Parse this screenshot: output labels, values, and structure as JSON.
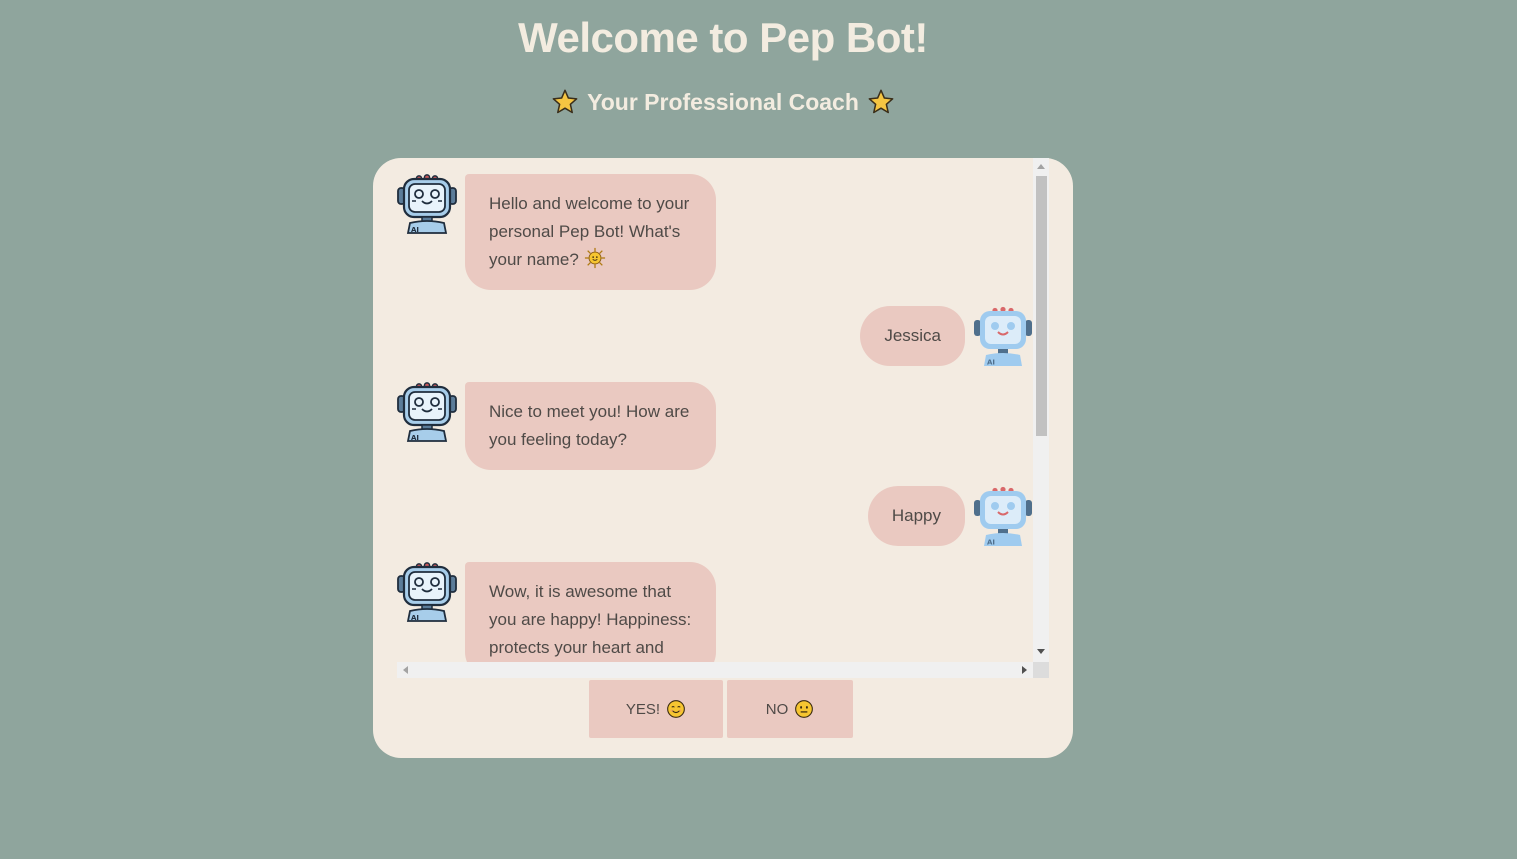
{
  "header": {
    "title": "Welcome to Pep Bot!",
    "subtitle": "Your Professional Coach",
    "subtitle_icons": [
      "star-icon",
      "star-icon"
    ]
  },
  "chat": {
    "messages": [
      {
        "sender": "bot",
        "text": "Hello and welcome to your personal Pep Bot! What's your name?",
        "trailing_icon": "sun-emoji-icon"
      },
      {
        "sender": "user",
        "text": "Jessica"
      },
      {
        "sender": "bot",
        "text": "Nice to meet you! How are you feeling today?"
      },
      {
        "sender": "user",
        "text": "Happy"
      },
      {
        "sender": "bot",
        "text": "Wow, it is awesome that you are happy! Happiness: protects your heart and"
      }
    ],
    "avatars": {
      "bot": "robot-avatar-icon",
      "user": "robot-avatar-light-icon"
    }
  },
  "actions": {
    "yes_label": "YES!",
    "yes_icon": "smiling-face-icon",
    "no_label": "NO",
    "no_icon": "neutral-face-icon"
  },
  "colors": {
    "background": "#8fa59d",
    "card": "#f3ebe1",
    "bubble": "#eac9c1",
    "title_text": "#f3ece0",
    "body_text": "#4f4a47"
  }
}
